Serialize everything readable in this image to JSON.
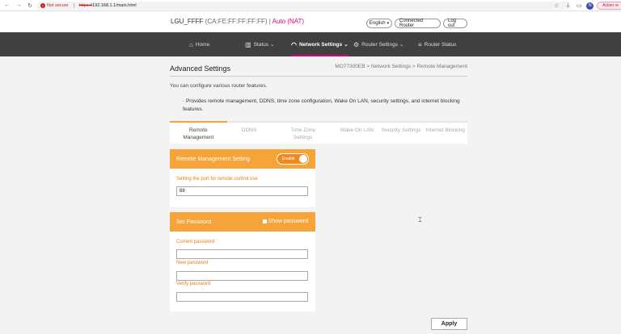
{
  "browser": {
    "not_secure": "Not secure",
    "url_scheme": "https://",
    "url_rest": "192.168.1.1/main.html",
    "action_label": "Action re"
  },
  "router": {
    "name": "LGU_FFFF",
    "mac": "(CA:FE:FF:FF:FF:FF)",
    "separator": "|",
    "nat": "Auto (NAT)",
    "language": "English",
    "connected_router": "Connected Router",
    "log_out": "Log out"
  },
  "nav": {
    "home": "Home",
    "status": "Status",
    "network_settings": "Network Settings",
    "router_settings": "Router Settings",
    "router_status": "Router Status"
  },
  "page": {
    "title": "Advanced Settings",
    "breadcrumb": "MO77300EB > Network Settings > Remote Management",
    "description": "You can configure various router features.",
    "bullet": "· Provides remote management, DDNS, time zone configuration, Wake On LAN, security settings, and internet blocking features."
  },
  "tabs": [
    {
      "label": "Remote Management",
      "active": true
    },
    {
      "label": "DDNS",
      "active": false
    },
    {
      "label": "Time Zone Settings",
      "active": false
    },
    {
      "label": "Wake On LAN",
      "active": false
    },
    {
      "label": "Security Settings",
      "active": false
    },
    {
      "label": "Internet Blocking",
      "active": false
    }
  ],
  "remote_panel": {
    "title": "Remote Management Setting",
    "toggle_label": "Enable",
    "toggle_on": true,
    "port_label": "Setting the port for remote control use",
    "port_value": "88"
  },
  "password_panel": {
    "title": "Set Password",
    "show_password": "Show password",
    "current_label": "Current password",
    "current_value": "",
    "new_label": "New password",
    "new_value": "",
    "verify_label": "Verify password",
    "verify_value": ""
  },
  "apply": "Apply",
  "colors": {
    "accent": "#f6a33a",
    "nav_bg": "#404040",
    "nav_active": "#e2007a"
  }
}
